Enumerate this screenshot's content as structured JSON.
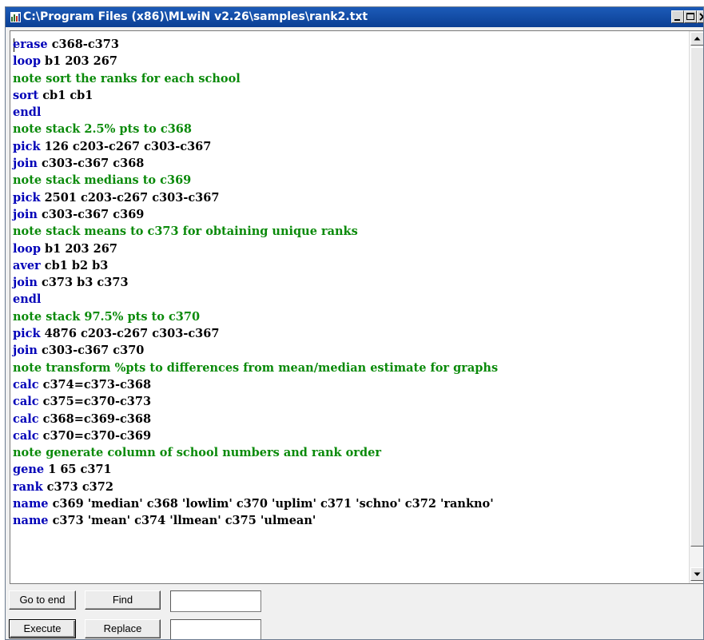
{
  "window": {
    "title": "C:\\Program Files (x86)\\MLwiN v2.26\\samples\\rank2.txt",
    "icon": "mlwin-app-icon",
    "controls": [
      "minimize-icon",
      "maximize-icon",
      "close-icon"
    ]
  },
  "colors": {
    "titlebar": "#1c5bb8",
    "keyword": "#0000b8",
    "note": "#0a8a0a",
    "text": "#000000"
  },
  "editor": {
    "lines": [
      {
        "kw": "erase",
        "args": " c368-c373"
      },
      {
        "kw": "loop",
        "args": " b1 203 267"
      },
      {
        "kw": "note",
        "args": " sort the ranks for each school"
      },
      {
        "kw": "sort",
        "args": " cb1 cb1"
      },
      {
        "kw": "endl",
        "args": ""
      },
      {
        "kw": "note",
        "args": " stack 2.5% pts to c368"
      },
      {
        "kw": "pick",
        "args": " 126 c203-c267 c303-c367"
      },
      {
        "kw": "join",
        "args": " c303-c367 c368"
      },
      {
        "kw": "note",
        "args": " stack medians to c369"
      },
      {
        "kw": "pick",
        "args": " 2501 c203-c267 c303-c367"
      },
      {
        "kw": "join",
        "args": " c303-c367 c369"
      },
      {
        "kw": "note",
        "args": " stack means to c373 for obtaining unique ranks"
      },
      {
        "kw": "loop",
        "args": " b1 203 267"
      },
      {
        "kw": "aver",
        "args": " cb1 b2 b3"
      },
      {
        "kw": "join",
        "args": " c373 b3 c373"
      },
      {
        "kw": "endl",
        "args": ""
      },
      {
        "kw": "note",
        "args": " stack 97.5% pts to c370"
      },
      {
        "kw": "pick",
        "args": " 4876 c203-c267 c303-c367"
      },
      {
        "kw": "join",
        "args": " c303-c367 c370"
      },
      {
        "kw": "note",
        "args": " transform %pts to differences from mean/median estimate for graphs"
      },
      {
        "kw": "calc",
        "args": " c374=c373-c368"
      },
      {
        "kw": "calc",
        "args": " c375=c370-c373"
      },
      {
        "kw": "calc",
        "args": " c368=c369-c368"
      },
      {
        "kw": "calc",
        "args": " c370=c370-c369"
      },
      {
        "kw": "note",
        "args": " generate column of school numbers and rank order"
      },
      {
        "kw": "gene",
        "args": " 1 65 c371"
      },
      {
        "kw": "rank",
        "args": " c373 c372"
      },
      {
        "kw": "name",
        "args": " c369 'median' c368 'lowlim' c370 'uplim' c371 'schno' c372 'rankno'"
      },
      {
        "kw": "name",
        "args": " c373 'mean' c374 'llmean' c375 'ulmean'"
      }
    ]
  },
  "toolbar": {
    "goto_end_label": "Go to end",
    "find_label": "Find",
    "find_value": "",
    "execute_label": "Execute",
    "replace_label": "Replace",
    "replace_value": ""
  }
}
